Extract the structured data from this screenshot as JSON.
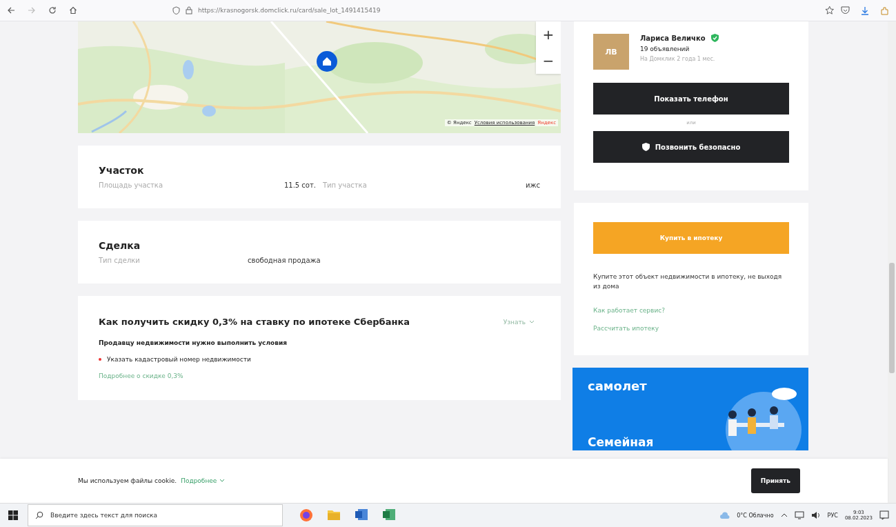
{
  "browser": {
    "url": "https://krasnogorsk.domclick.ru/card/sale_lot_1491415419"
  },
  "map": {
    "attribution": "© Яндекс",
    "terms_link": "Условия использования",
    "brand": "Яндекс",
    "zoom_in": "+",
    "zoom_out": "−"
  },
  "sections": [
    {
      "title": "Участок",
      "fields": [
        {
          "label": "Площадь участка",
          "value": "11.5 сот."
        },
        {
          "label": "Тип участка",
          "value": "ижс"
        }
      ]
    },
    {
      "title": "Сделка",
      "fields": [
        {
          "label": "Тип сделки",
          "value": "свободная продажа"
        }
      ]
    }
  ],
  "discount": {
    "title": "Как получить скидку 0,3% на ставку по ипотеке Сбербанка",
    "toggle": "Узнать",
    "subtitle": "Продавцу недвижимости нужно выполнить условия",
    "conditions": [
      "Указать кадастровый номер недвижимости"
    ],
    "link": "Подробнее о скидке 0,3%"
  },
  "seller": {
    "initials": "ЛВ",
    "name": "Лариса Величко",
    "verified": true,
    "listings": "19 объявлений",
    "since": "На Домклик 2 года 1 мес.",
    "phone_button": "Показать телефон",
    "or": "или",
    "call_button": "Позвонить безопасно"
  },
  "mortgage": {
    "button": "Купить в ипотеку",
    "text": "Купите этот объект недвижимости в ипотеку, не выходя из дома",
    "links": [
      "Как работает сервис?",
      "Рассчитать ипотеку"
    ]
  },
  "ad": {
    "brand": "самолет",
    "headline": "Семейная"
  },
  "cookie": {
    "text": "Мы используем файлы cookie.",
    "link": "Подробнее",
    "button": "Принять"
  },
  "taskbar": {
    "search_placeholder": "Введите здесь текст для поиска",
    "weather": "0°C Облачно",
    "language": "РУС",
    "time": "9:03",
    "date": "08.02.2023"
  }
}
